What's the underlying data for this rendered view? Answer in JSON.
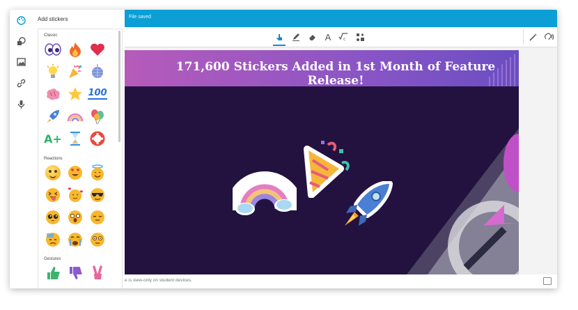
{
  "status": {
    "saved": "File saved"
  },
  "panel": {
    "title": "Add stickers",
    "sections": {
      "classic": "Classic",
      "reactions": "Reactions",
      "gestures": "Gestures"
    },
    "classic_stickers": [
      "eyes",
      "fire",
      "heart",
      "lightbulb",
      "party-popper",
      "disco-ball",
      "brain",
      "star",
      "hundred",
      "rocket",
      "rainbow",
      "balloons",
      "a-plus",
      "hourglass",
      "life-ring"
    ],
    "reaction_stickers": [
      "smile",
      "heart-eyes",
      "halo",
      "tongue-wink",
      "hearts-face",
      "sunglasses",
      "pleading",
      "surprised",
      "relieved",
      "sweat",
      "crying",
      "flushed"
    ],
    "gesture_stickers": [
      "thumbs-up",
      "thumbs-down",
      "victory"
    ],
    "hundred_text": "100",
    "aplus_text": "A+"
  },
  "slide": {
    "title": "171,600 Stickers Added in 1st Month of Feature Release!"
  },
  "footer": {
    "note": "e is view-only on student devices."
  },
  "toolbar": {
    "tools": [
      "touch-icon",
      "pen-icon",
      "eraser-icon",
      "text-icon",
      "math-icon",
      "shapes-icon"
    ],
    "text_glyph": "A"
  },
  "colors": {
    "accent": "#0b9fd6",
    "slide_bg": "#23123f",
    "banner_start": "#b65bba",
    "banner_end": "#6a4ec2"
  }
}
